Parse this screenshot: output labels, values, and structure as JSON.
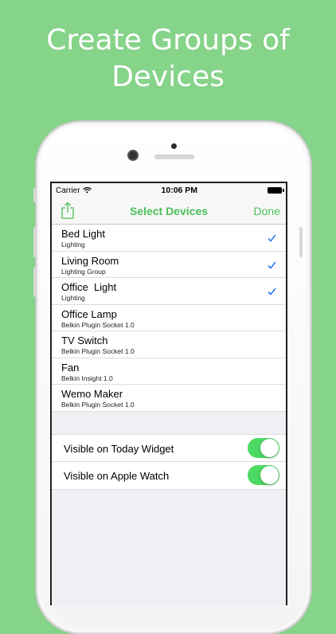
{
  "headline": {
    "line1": "Create Groups of",
    "line2": "Devices"
  },
  "status_bar": {
    "carrier": "Carrier",
    "time": "10:06 PM"
  },
  "nav_bar": {
    "title": "Select Devices",
    "done_label": "Done",
    "share_icon": "share-icon"
  },
  "devices": [
    {
      "name": "Bed Light",
      "type": "Lighting",
      "selected": true
    },
    {
      "name": "Living Room",
      "type": "Lighting Group",
      "selected": true
    },
    {
      "name": "Office  Light",
      "type": "Lighting",
      "selected": true
    },
    {
      "name": "Office Lamp",
      "type": "Belkin Plugin Socket 1.0",
      "selected": false
    },
    {
      "name": "TV Switch",
      "type": "Belkin Plugin Socket 1.0",
      "selected": false
    },
    {
      "name": "Fan",
      "type": "Belkin Insight 1.0",
      "selected": false
    },
    {
      "name": "Wemo Maker",
      "type": "Belkin Plugin Socket 1.0",
      "selected": false
    }
  ],
  "settings": [
    {
      "label": "Visible on Today Widget",
      "enabled": true
    },
    {
      "label": "Visible on Apple Watch",
      "enabled": true
    }
  ],
  "colors": {
    "background": "#86d38a",
    "accent": "#4cc05a",
    "checkmark": "#2b7de9",
    "toggle_on": "#4cd964"
  }
}
